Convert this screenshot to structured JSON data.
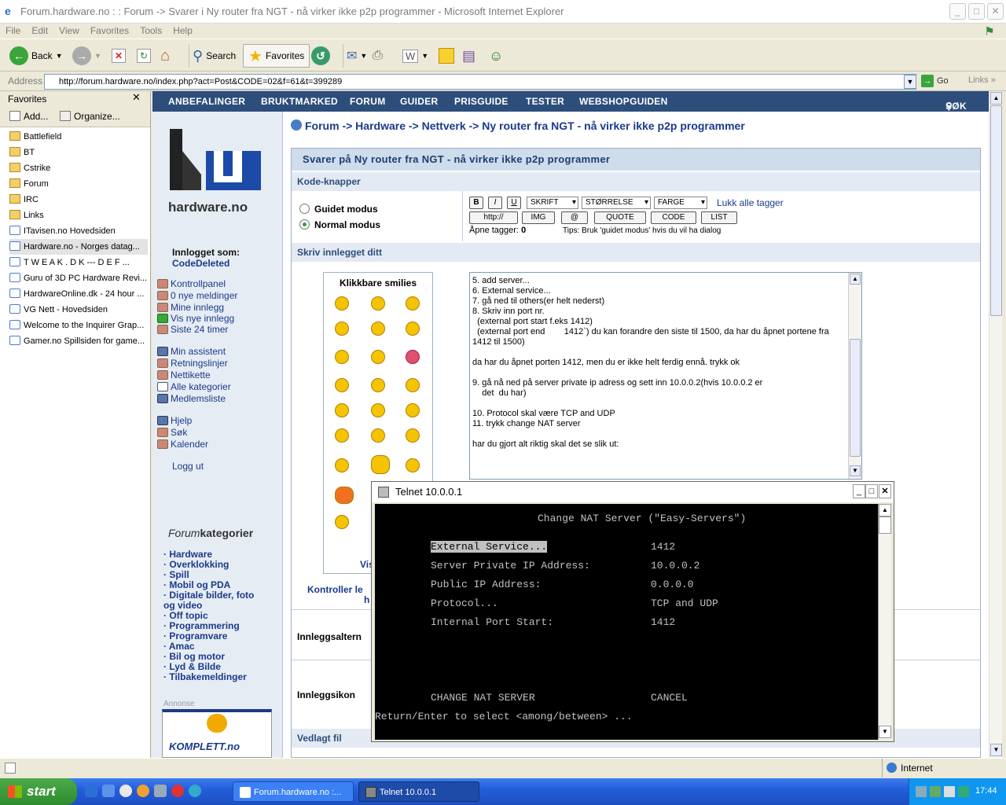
{
  "window": {
    "title": "Forum.hardware.no : : Forum -> Svarer i Ny router fra NGT - nå virker ikke p2p programmer - Microsoft Internet Explorer"
  },
  "menu": [
    "File",
    "Edit",
    "View",
    "Favorites",
    "Tools",
    "Help"
  ],
  "toolbar": {
    "back": "Back",
    "search": "Search",
    "favorites": "Favorites"
  },
  "address": {
    "label": "Address",
    "url": "http://forum.hardware.no/index.php?act=Post&CODE=02&f=61&t=399289",
    "go": "Go",
    "links": "Links"
  },
  "favorites": {
    "title": "Favorites",
    "add": "Add...",
    "organize": "Organize...",
    "items": [
      {
        "label": "Battlefield",
        "type": "folder"
      },
      {
        "label": "BT",
        "type": "folder"
      },
      {
        "label": "Cstrike",
        "type": "folder"
      },
      {
        "label": "Forum",
        "type": "folder"
      },
      {
        "label": "IRC",
        "type": "folder"
      },
      {
        "label": "Links",
        "type": "folder"
      },
      {
        "label": "ITavisen.no  Hovedsiden",
        "type": "page"
      },
      {
        "label": "Hardware.no - Norges datag...",
        "type": "page"
      },
      {
        "label": "T W E A K . D K  ---  D E  F ...",
        "type": "page"
      },
      {
        "label": "Guru of 3D PC Hardware Revi...",
        "type": "page"
      },
      {
        "label": "HardwareOnline.dk - 24 hour ...",
        "type": "page"
      },
      {
        "label": "VG Nett - Hovedsiden",
        "type": "page"
      },
      {
        "label": "Welcome to the Inquirer Grap...",
        "type": "page"
      },
      {
        "label": "Gamer.no  Spillsiden for game...",
        "type": "page"
      }
    ]
  },
  "site": {
    "nav": [
      "ANBEFALINGER",
      "BRUKTMARKED",
      "FORUM",
      "GUIDER",
      "PRISGUIDE",
      "TESTER",
      "WEBSHOPGUIDEN"
    ],
    "search": "SØK",
    "logo_text": "hardware.no",
    "logged_in_label": "Innlogget som:",
    "username": "CodeDeleted",
    "links1": [
      "Kontrollpanel",
      "0 nye meldinger",
      "Mine innlegg",
      "Vis nye innlegg",
      "Siste 24 timer"
    ],
    "links2": [
      "Min assistent",
      "Retningslinjer",
      "Nettikette",
      "Alle kategorier",
      "Medlemsliste"
    ],
    "links3": [
      "Hjelp",
      "Søk",
      "Kalender"
    ],
    "logout": "Logg ut",
    "forumkat_a": "Forum",
    "forumkat_b": "kategorier",
    "categories": [
      "Hardware",
      "Overklokking",
      "Spill",
      "Mobil og PDA",
      "Digitale bilder, foto",
      "og video",
      "Off topic",
      "Programmering",
      "Programvare",
      "Amac",
      "Bil og motor",
      "Lyd & Bilde",
      "Tilbakemeldinger"
    ],
    "annonse": "Annonse",
    "ad_text": "KOMPLETT.no"
  },
  "post": {
    "breadcrumb": "Forum -> Hardware -> Nettverk -> Ny router fra NGT - nå virker ikke p2p programmer",
    "reply_title": "Svarer på Ny router fra NGT - nå virker ikke p2p programmer",
    "kode_knapper": "Kode-knapper",
    "guidet": "Guidet modus",
    "normal": "Normal modus",
    "btn_b": "B",
    "btn_i": "I",
    "btn_u": "U",
    "skrift": "SKRIFT",
    "storrelse": "STØRRELSE",
    "farge": "FARGE",
    "lukk": "Lukk alle tagger",
    "http": "http://",
    "img": "IMG",
    "at": "@",
    "quote": "QUOTE",
    "code": "CODE",
    "list": "LIST",
    "apne_tagger": "Åpne tagger:",
    "apne_count": "0",
    "tips": "Tips: Bruk 'guidet modus' hvis du vil ha dialog",
    "skriv": "Skriv innlegget ditt",
    "smilies_title": "Klikkbare smilies",
    "vis": "Vis",
    "kontroller": "Kontroller le",
    "kontroller2": "h",
    "innleggsaltern": "Innleggsaltern",
    "innleggsikon": "Innleggsikon",
    "vedlagt": "Vedlagt fil",
    "body": "5. add server...\n6. External service...\n7. gå ned til others(er helt nederst)\n8. Skriv inn port nr.\n  (external port start f.eks 1412)\n  (external port end        1412`) du kan forandre den siste til 1500, da har du åpnet portene fra 1412 til 1500)\n\nda har du åpnet porten 1412, men du er ikke helt ferdig ennå. trykk ok\n\n9. gå nå ned på server private ip adress og sett inn 10.0.0.2(hvis 10.0.0.2 er\n    det  du har)\n\n10. Protocol skal være TCP and UDP\n11. trykk change NAT server\n\nhar du gjort alt riktig skal det se slik ut:"
  },
  "telnet": {
    "title": "Telnet 10.0.0.1",
    "heading": "Change NAT Server (\"Easy-Servers\")",
    "rows": [
      {
        "label": "External Service...",
        "value": "1412"
      },
      {
        "label": "Server Private IP Address:",
        "value": "10.0.0.2"
      },
      {
        "label": "Public IP Address:",
        "value": "0.0.0.0"
      },
      {
        "label": "Protocol...",
        "value": "TCP and UDP"
      },
      {
        "label": "Internal Port Start:",
        "value": "1412"
      }
    ],
    "action1": "CHANGE NAT SERVER",
    "action2": "CANCEL",
    "hint": "Return/Enter to select <among/between> ..."
  },
  "status": {
    "zone": "Internet"
  },
  "taskbar": {
    "start": "start",
    "task1": "Forum.hardware.no :...",
    "task2": "Telnet 10.0.0.1",
    "clock": "17:44"
  }
}
